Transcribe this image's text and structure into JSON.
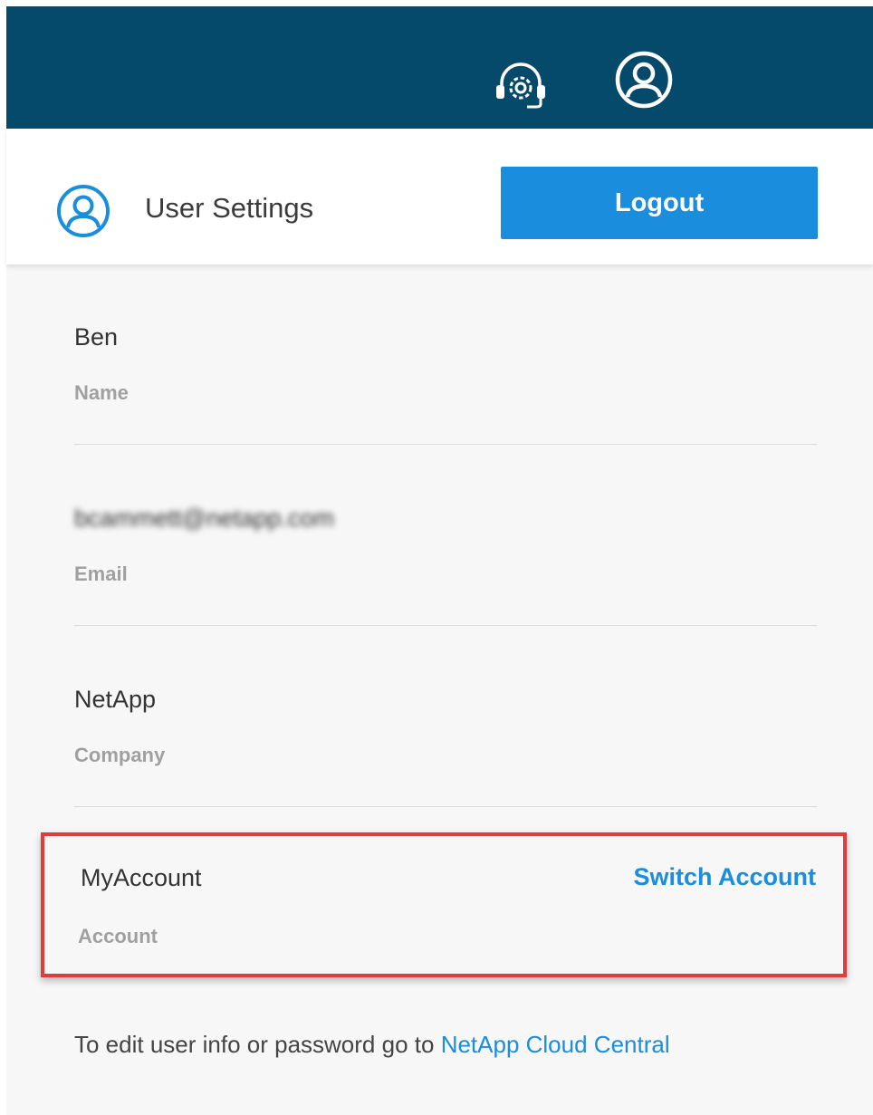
{
  "topbar": {
    "background": "#064a6b",
    "icons": [
      "support-headset-icon",
      "user-account-icon"
    ]
  },
  "settings": {
    "title": "User Settings",
    "logout_label": "Logout",
    "accent_color": "#1a8ddd"
  },
  "fields": [
    {
      "value": "Ben",
      "label": "Name"
    },
    {
      "value": "bcammett@netapp.com",
      "label": "Email"
    },
    {
      "value": "NetApp",
      "label": "Company"
    }
  ],
  "account": {
    "value": "MyAccount",
    "label": "Account",
    "switch_label": "Switch Account",
    "highlight_color": "#e03c3c"
  },
  "footer": {
    "text": "To edit user info or password go to",
    "link": "NetApp Cloud Central"
  }
}
